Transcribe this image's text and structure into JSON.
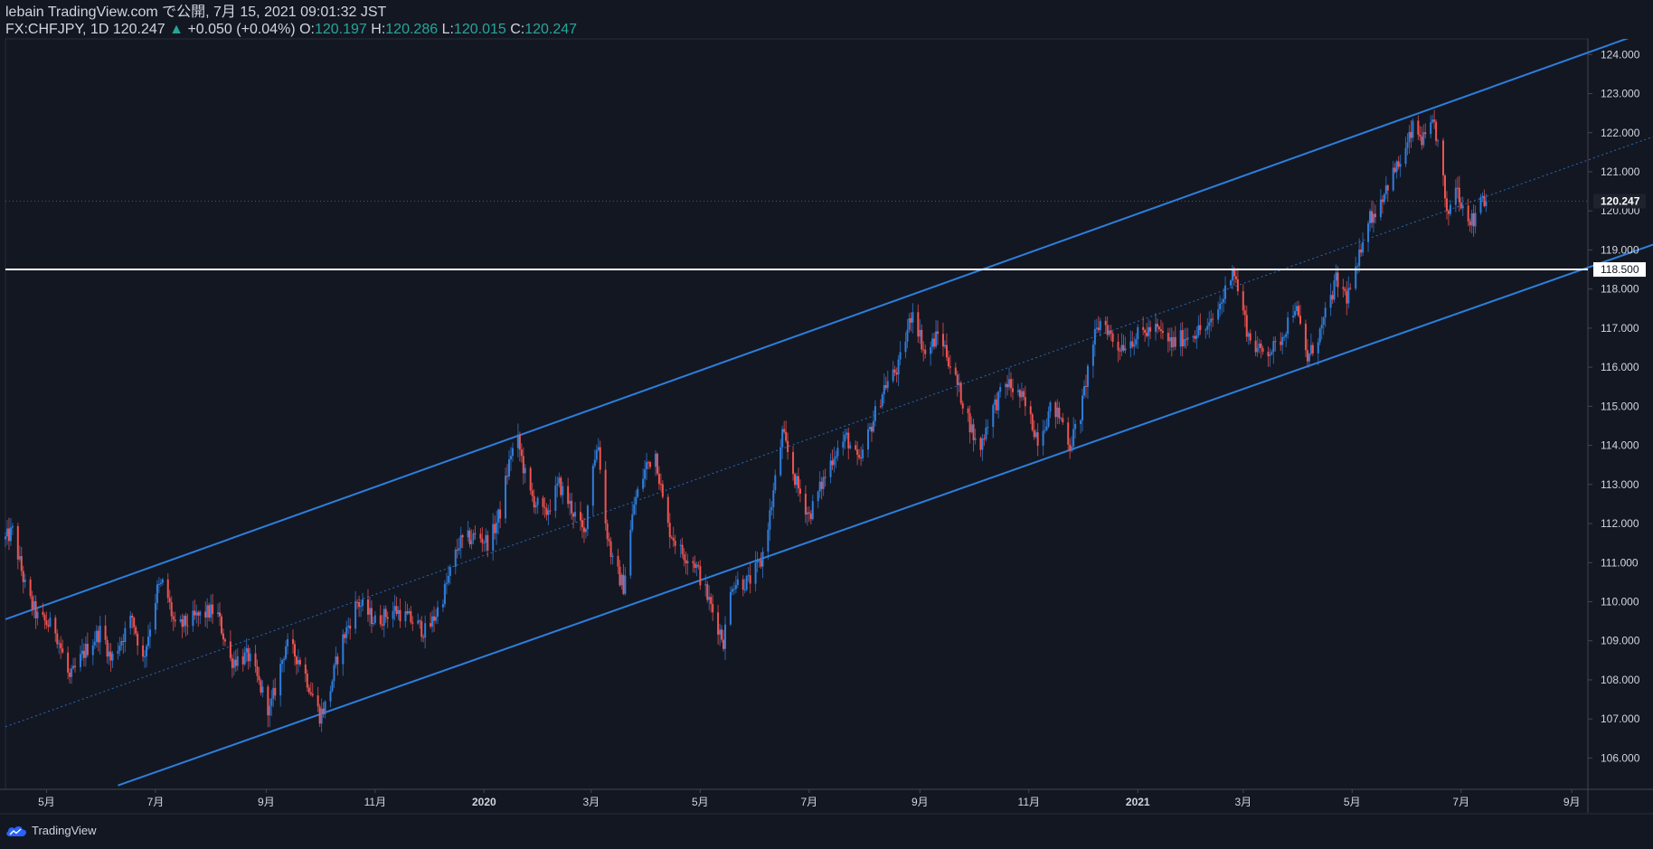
{
  "header": {
    "title": "lebain TradingView.com で公開, 7月 15, 2021 09:01:32 JST",
    "symbol_line": "FX:CHFJPY, 1D 120.247",
    "change_arrow": "▲",
    "change": "+0.050 (+0.04%)",
    "ohlc": [
      {
        "label": "O:",
        "value": "120.197"
      },
      {
        "label": "H:",
        "value": "120.286"
      },
      {
        "label": "L:",
        "value": "120.015"
      },
      {
        "label": "C:",
        "value": "120.247"
      }
    ]
  },
  "footer": {
    "brand": "TradingView",
    "logo_icon": "tradingview-cloud-icon"
  },
  "colors": {
    "background": "#131722",
    "up_candle": "#2f7ddb",
    "down_candle": "#ef5350",
    "channel": "#2d7fdc",
    "support_line": "#ffffff",
    "axis_text": "#d1d4dc",
    "positive": "#26a69a"
  },
  "chart_data": {
    "type": "candlestick",
    "symbol": "FX:CHFJPY",
    "interval": "1D",
    "ylim": [
      105.2,
      124.4
    ],
    "y_ticks": [
      "106.000",
      "107.000",
      "108.000",
      "109.000",
      "110.000",
      "111.000",
      "112.000",
      "113.000",
      "114.000",
      "115.000",
      "116.000",
      "117.000",
      "118.000",
      "119.000",
      "120.000",
      "121.000",
      "122.000",
      "123.000",
      "124.000"
    ],
    "x_ticks": [
      {
        "label": "5月",
        "date": "2019-05-01"
      },
      {
        "label": "7月",
        "date": "2019-07-01"
      },
      {
        "label": "9月",
        "date": "2019-09-01"
      },
      {
        "label": "11月",
        "date": "2019-11-01"
      },
      {
        "label": "2020",
        "date": "2020-01-01"
      },
      {
        "label": "3月",
        "date": "2020-03-01"
      },
      {
        "label": "5月",
        "date": "2020-05-01"
      },
      {
        "label": "7月",
        "date": "2020-07-01"
      },
      {
        "label": "9月",
        "date": "2020-09-01"
      },
      {
        "label": "11月",
        "date": "2020-11-01"
      },
      {
        "label": "2021",
        "date": "2021-01-01"
      },
      {
        "label": "3月",
        "date": "2021-03-01"
      },
      {
        "label": "5月",
        "date": "2021-05-01"
      },
      {
        "label": "7月",
        "date": "2021-07-01"
      },
      {
        "label": "9月",
        "date": "2021-09-01"
      }
    ],
    "xlim": [
      "2019-04-08",
      "2021-09-10"
    ],
    "last_price": {
      "value": 120.247,
      "label": "120.247"
    },
    "horizontal_line": {
      "value": 118.5,
      "label": "118.500"
    },
    "channel": {
      "upper": [
        {
          "date": "2019-04-08",
          "value": 109.55
        },
        {
          "date": "2021-09-10",
          "value": 124.05
        }
      ],
      "lower": [
        {
          "date": "2019-06-10",
          "value": 105.3
        },
        {
          "date": "2021-09-10",
          "value": 118.55
        }
      ],
      "middle": [
        {
          "date": "2019-04-08",
          "value": 106.8
        },
        {
          "date": "2021-09-10",
          "value": 121.3
        }
      ]
    },
    "price_path": [
      {
        "date": "2019-04-08",
        "value": 111.6
      },
      {
        "date": "2019-04-12",
        "value": 111.8
      },
      {
        "date": "2019-04-20",
        "value": 110.2
      },
      {
        "date": "2019-04-26",
        "value": 109.6
      },
      {
        "date": "2019-05-06",
        "value": 109.3
      },
      {
        "date": "2019-05-14",
        "value": 108.0
      },
      {
        "date": "2019-05-22",
        "value": 108.7
      },
      {
        "date": "2019-06-01",
        "value": 109.3
      },
      {
        "date": "2019-06-06",
        "value": 108.5
      },
      {
        "date": "2019-06-18",
        "value": 109.6
      },
      {
        "date": "2019-06-24",
        "value": 108.5
      },
      {
        "date": "2019-07-02",
        "value": 110.3
      },
      {
        "date": "2019-07-06",
        "value": 110.5
      },
      {
        "date": "2019-07-12",
        "value": 109.3
      },
      {
        "date": "2019-07-24",
        "value": 109.6
      },
      {
        "date": "2019-08-04",
        "value": 109.8
      },
      {
        "date": "2019-08-12",
        "value": 108.5
      },
      {
        "date": "2019-08-22",
        "value": 108.6
      },
      {
        "date": "2019-08-28",
        "value": 107.9
      },
      {
        "date": "2019-09-03",
        "value": 107.2
      },
      {
        "date": "2019-09-12",
        "value": 108.9
      },
      {
        "date": "2019-09-20",
        "value": 108.5
      },
      {
        "date": "2019-10-01",
        "value": 107.1
      },
      {
        "date": "2019-10-05",
        "value": 107.4
      },
      {
        "date": "2019-10-12",
        "value": 108.8
      },
      {
        "date": "2019-10-22",
        "value": 110.0
      },
      {
        "date": "2019-11-01",
        "value": 109.5
      },
      {
        "date": "2019-11-12",
        "value": 109.8
      },
      {
        "date": "2019-11-22",
        "value": 109.5
      },
      {
        "date": "2019-11-30",
        "value": 109.2
      },
      {
        "date": "2019-12-08",
        "value": 110.0
      },
      {
        "date": "2019-12-18",
        "value": 111.5
      },
      {
        "date": "2019-12-28",
        "value": 111.7
      },
      {
        "date": "2020-01-04",
        "value": 111.5
      },
      {
        "date": "2020-01-10",
        "value": 112.3
      },
      {
        "date": "2020-01-16",
        "value": 113.8
      },
      {
        "date": "2020-01-20",
        "value": 114.1
      },
      {
        "date": "2020-01-26",
        "value": 112.8
      },
      {
        "date": "2020-02-04",
        "value": 112.2
      },
      {
        "date": "2020-02-12",
        "value": 113.0
      },
      {
        "date": "2020-02-20",
        "value": 112.3
      },
      {
        "date": "2020-02-26",
        "value": 111.7
      },
      {
        "date": "2020-03-02",
        "value": 113.6
      },
      {
        "date": "2020-03-05",
        "value": 114.0
      },
      {
        "date": "2020-03-09",
        "value": 112.0
      },
      {
        "date": "2020-03-13",
        "value": 111.0
      },
      {
        "date": "2020-03-19",
        "value": 110.4
      },
      {
        "date": "2020-03-25",
        "value": 112.5
      },
      {
        "date": "2020-04-01",
        "value": 113.5
      },
      {
        "date": "2020-04-06",
        "value": 113.8
      },
      {
        "date": "2020-04-12",
        "value": 112.0
      },
      {
        "date": "2020-04-20",
        "value": 111.3
      },
      {
        "date": "2020-04-28",
        "value": 111.0
      },
      {
        "date": "2020-05-06",
        "value": 110.0
      },
      {
        "date": "2020-05-14",
        "value": 109.0
      },
      {
        "date": "2020-05-19",
        "value": 110.5
      },
      {
        "date": "2020-05-28",
        "value": 110.5
      },
      {
        "date": "2020-06-04",
        "value": 111.0
      },
      {
        "date": "2020-06-10",
        "value": 112.5
      },
      {
        "date": "2020-06-16",
        "value": 114.3
      },
      {
        "date": "2020-06-24",
        "value": 113.0
      },
      {
        "date": "2020-07-01",
        "value": 112.2
      },
      {
        "date": "2020-07-08",
        "value": 113.0
      },
      {
        "date": "2020-07-15",
        "value": 113.8
      },
      {
        "date": "2020-07-22",
        "value": 114.2
      },
      {
        "date": "2020-07-29",
        "value": 113.5
      },
      {
        "date": "2020-08-04",
        "value": 114.4
      },
      {
        "date": "2020-08-12",
        "value": 115.5
      },
      {
        "date": "2020-08-20",
        "value": 116.0
      },
      {
        "date": "2020-08-28",
        "value": 117.5
      },
      {
        "date": "2020-09-04",
        "value": 116.3
      },
      {
        "date": "2020-09-12",
        "value": 116.9
      },
      {
        "date": "2020-09-20",
        "value": 115.8
      },
      {
        "date": "2020-09-26",
        "value": 115.0
      },
      {
        "date": "2020-10-04",
        "value": 113.8
      },
      {
        "date": "2020-10-10",
        "value": 114.8
      },
      {
        "date": "2020-10-20",
        "value": 115.6
      },
      {
        "date": "2020-10-28",
        "value": 115.2
      },
      {
        "date": "2020-11-06",
        "value": 114.2
      },
      {
        "date": "2020-11-14",
        "value": 115.0
      },
      {
        "date": "2020-11-20",
        "value": 114.6
      },
      {
        "date": "2020-11-24",
        "value": 114.0
      },
      {
        "date": "2020-11-30",
        "value": 114.8
      },
      {
        "date": "2020-12-06",
        "value": 116.5
      },
      {
        "date": "2020-12-12",
        "value": 117.3
      },
      {
        "date": "2020-12-20",
        "value": 116.5
      },
      {
        "date": "2021-01-01",
        "value": 116.8
      },
      {
        "date": "2021-01-10",
        "value": 117.0
      },
      {
        "date": "2021-01-20",
        "value": 116.6
      },
      {
        "date": "2021-02-01",
        "value": 116.9
      },
      {
        "date": "2021-02-10",
        "value": 117.0
      },
      {
        "date": "2021-02-18",
        "value": 117.8
      },
      {
        "date": "2021-02-23",
        "value": 118.6
      },
      {
        "date": "2021-02-27",
        "value": 117.8
      },
      {
        "date": "2021-03-04",
        "value": 116.8
      },
      {
        "date": "2021-03-10",
        "value": 116.4
      },
      {
        "date": "2021-03-20",
        "value": 116.5
      },
      {
        "date": "2021-03-30",
        "value": 117.6
      },
      {
        "date": "2021-04-06",
        "value": 116.2
      },
      {
        "date": "2021-04-14",
        "value": 117.0
      },
      {
        "date": "2021-04-22",
        "value": 118.2
      },
      {
        "date": "2021-04-28",
        "value": 117.8
      },
      {
        "date": "2021-05-04",
        "value": 118.5
      },
      {
        "date": "2021-05-08",
        "value": 119.7
      },
      {
        "date": "2021-05-14",
        "value": 120.0
      },
      {
        "date": "2021-05-22",
        "value": 120.8
      },
      {
        "date": "2021-05-30",
        "value": 121.4
      },
      {
        "date": "2021-06-04",
        "value": 122.1
      },
      {
        "date": "2021-06-10",
        "value": 121.8
      },
      {
        "date": "2021-06-16",
        "value": 122.2
      },
      {
        "date": "2021-06-20",
        "value": 121.2
      },
      {
        "date": "2021-06-23",
        "value": 119.8
      },
      {
        "date": "2021-06-28",
        "value": 120.7
      },
      {
        "date": "2021-07-03",
        "value": 120.0
      },
      {
        "date": "2021-07-08",
        "value": 119.7
      },
      {
        "date": "2021-07-11",
        "value": 120.5
      },
      {
        "date": "2021-07-15",
        "value": 120.25
      }
    ]
  }
}
